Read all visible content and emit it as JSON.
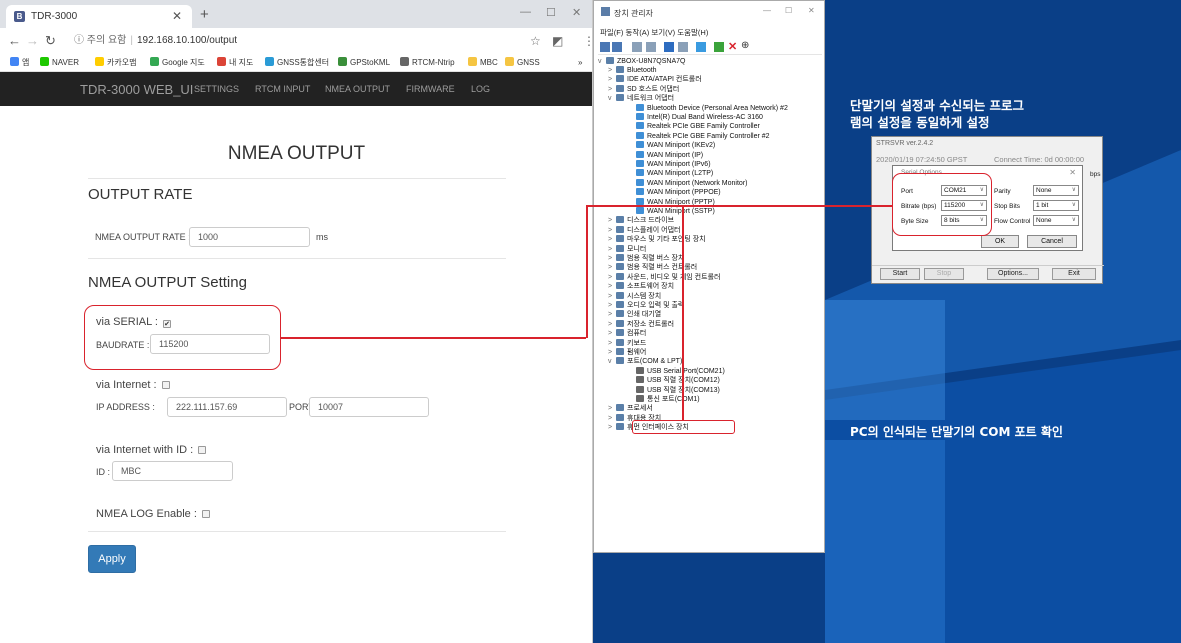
{
  "browser": {
    "tab_title": "TDR-3000",
    "tab_icon": "B",
    "new_tab": "+",
    "address": {
      "security": "ⓘ 주의 요함",
      "url": "192.168.10.100/output"
    },
    "bookmarks": [
      "앱",
      "NAVER",
      "카카오맵",
      "Google 지도",
      "내 지도",
      "GNSS통합센터",
      "GPStoKML",
      "RTCM-Ntrip",
      "MBC",
      "GNSS"
    ],
    "bookmarks_more": "»"
  },
  "app": {
    "brand": "TDR-3000 WEB_UI",
    "nav": [
      "SETTINGS",
      "RTCM INPUT",
      "NMEA OUTPUT",
      "FIRMWARE",
      "LOG"
    ],
    "page_title": "NMEA OUTPUT",
    "rate_section": "OUTPUT RATE",
    "rate_label": "NMEA OUTPUT RATE :",
    "rate_value": "1000",
    "rate_unit": "ms",
    "setting_section": "NMEA OUTPUT Setting",
    "serial_label": "via SERIAL :",
    "serial_checked": true,
    "baud_label": "BAUDRATE :",
    "baud_value": "115200",
    "internet_label": "via Internet :",
    "ip_label": "IP ADDRESS :",
    "ip_value": "222.111.157.69",
    "port_label": "PORT :",
    "port_value": "10007",
    "internet_id_label": "via Internet with ID :",
    "id_label": "ID :",
    "id_value": "MBC",
    "log_label": "NMEA LOG Enable :",
    "apply": "Apply"
  },
  "devmgr": {
    "title": "장치 관리자",
    "menu": "파일(F)  동작(A)  보기(V)  도움말(H)",
    "root": "ZBOX-U8N7QSNA7Q",
    "items": [
      {
        "ex": ">",
        "label": "Bluetooth"
      },
      {
        "ex": ">",
        "label": "IDE ATA/ATAPI 컨트롤러"
      },
      {
        "ex": ">",
        "label": "SD 호스트 어댑터"
      },
      {
        "ex": "v",
        "label": "네트워크 어댑터"
      },
      {
        "ex": "",
        "label": "Bluetooth Device (Personal Area Network) #2",
        "child": true
      },
      {
        "ex": "",
        "label": "Intel(R) Dual Band Wireless-AC 3160",
        "child": true
      },
      {
        "ex": "",
        "label": "Realtek PCIe GBE Family Controller",
        "child": true
      },
      {
        "ex": "",
        "label": "Realtek PCIe GBE Family Controller #2",
        "child": true
      },
      {
        "ex": "",
        "label": "WAN Miniport (IKEv2)",
        "child": true
      },
      {
        "ex": "",
        "label": "WAN Miniport (IP)",
        "child": true
      },
      {
        "ex": "",
        "label": "WAN Miniport (IPv6)",
        "child": true
      },
      {
        "ex": "",
        "label": "WAN Miniport (L2TP)",
        "child": true
      },
      {
        "ex": "",
        "label": "WAN Miniport (Network Monitor)",
        "child": true
      },
      {
        "ex": "",
        "label": "WAN Miniport (PPPOE)",
        "child": true
      },
      {
        "ex": "",
        "label": "WAN Miniport (PPTP)",
        "child": true
      },
      {
        "ex": "",
        "label": "WAN Miniport (SSTP)",
        "child": true
      },
      {
        "ex": ">",
        "label": "디스크 드라이브"
      },
      {
        "ex": ">",
        "label": "디스플레이 어댑터"
      },
      {
        "ex": ">",
        "label": "마우스 및 기타 포인팅 장치"
      },
      {
        "ex": ">",
        "label": "모니터"
      },
      {
        "ex": ">",
        "label": "범용 직렬 버스 장치"
      },
      {
        "ex": ">",
        "label": "범용 직렬 버스 컨트롤러"
      },
      {
        "ex": ">",
        "label": "사운드, 비디오 및 게임 컨트롤러"
      },
      {
        "ex": ">",
        "label": "소프트웨어 장치"
      },
      {
        "ex": ">",
        "label": "시스템 장치"
      },
      {
        "ex": ">",
        "label": "오디오 입력 및 출력"
      },
      {
        "ex": ">",
        "label": "인쇄 대기열"
      },
      {
        "ex": ">",
        "label": "저장소 컨트롤러"
      },
      {
        "ex": ">",
        "label": "컴퓨터"
      },
      {
        "ex": ">",
        "label": "키보드"
      },
      {
        "ex": ">",
        "label": "펌웨어"
      },
      {
        "ex": "v",
        "label": "포트(COM & LPT)"
      },
      {
        "ex": "",
        "label": "USB Serial Port(COM21)",
        "child": true,
        "usb": true
      },
      {
        "ex": "",
        "label": "USB 직렬 장치(COM12)",
        "child": true,
        "usb": true
      },
      {
        "ex": "",
        "label": "USB 직렬 장치(COM13)",
        "child": true,
        "usb": true
      },
      {
        "ex": "",
        "label": "통신 포트(COM1)",
        "child": true,
        "usb": true
      },
      {
        "ex": ">",
        "label": "프로세서"
      },
      {
        "ex": ">",
        "label": "휴대용 장치"
      },
      {
        "ex": ">",
        "label": "휴먼 인터페이스 장치"
      }
    ]
  },
  "strsvr": {
    "title": "STRSVR ver.2.4.2",
    "time": "2020/01/19 07:24:50 GPST",
    "connect": "Connect Time:   0d 00:00:00",
    "bps": "bps",
    "start": "Start",
    "stop": "Stop",
    "options": "Options...",
    "exit": "Exit"
  },
  "serial_dialog": {
    "title": "Serial Options",
    "port_label": "Port",
    "port_value": "COM21",
    "bitrate_label": "Bitrate (bps)",
    "bitrate_value": "115200",
    "bytesize_label": "Byte Size",
    "bytesize_value": "8 bits",
    "parity_label": "Parity",
    "parity_value": "None",
    "stopbits_label": "Stop Bits",
    "stopbits_value": "1 bit",
    "flow_label": "Flow Control",
    "flow_value": "None",
    "ok": "OK",
    "cancel": "Cancel"
  },
  "annotations": {
    "top": "단말기의 설정과 수신되는 프로그\n램의 설정을 동일하게 설정",
    "bottom": "PC의 인식되는 단말기의 COM 포트 확인"
  },
  "colors": {
    "highlight": "#d9232d",
    "desktop": "#0a3f87",
    "apply": "#337ab7"
  }
}
